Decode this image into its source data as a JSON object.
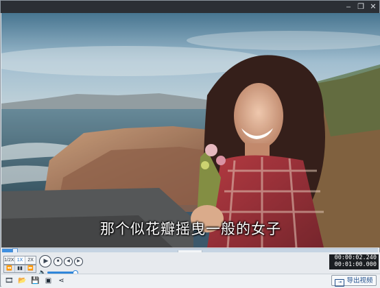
{
  "window": {
    "minimize_glyph": "–",
    "restore_glyph": "❐",
    "close_glyph": "✕"
  },
  "video": {
    "subtitle": "那个似花瓣摇曳一般的女子",
    "playback_progress": 0.034
  },
  "controls": {
    "speed_options": [
      "1/2X",
      "1X",
      "2X"
    ],
    "speed_selected": "1X",
    "step_buttons": [
      "⏪",
      "▮▮",
      "⏩"
    ],
    "play_glyph": "▶",
    "stop_glyph": "■",
    "prev_glyph": "◀",
    "next_glyph": "▶",
    "volume_glyph": "🔈",
    "volume_level": 0.92,
    "time_current": "00:00:02.240",
    "time_total": "00:01:00.000"
  },
  "toolbar": {
    "icons": [
      "film-icon",
      "open-folder-icon",
      "save-icon",
      "snapshot-icon",
      "share-icon"
    ],
    "export_label": "导出视频"
  },
  "colors": {
    "accent": "#3f8fe0",
    "titlebar": "#2b2f35"
  }
}
